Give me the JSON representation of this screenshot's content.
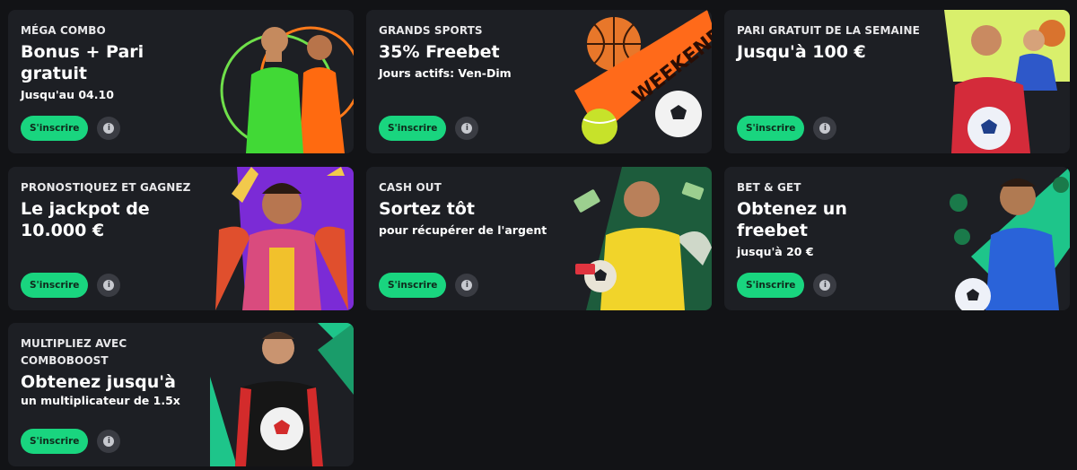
{
  "promos": [
    {
      "kicker": "MÉGA COMBO",
      "title": "Bonus + Pari gratuit",
      "sub": "Jusqu'au 04.10",
      "cta": "S'inscrire"
    },
    {
      "kicker": "GRANDS SPORTS",
      "title": "35% Freebet",
      "sub": "Jours actifs: Ven-Dim",
      "cta": "S'inscrire",
      "banner": "WEEKEND"
    },
    {
      "kicker": "PARI GRATUIT DE LA SEMAINE",
      "title": "Jusqu'à 100 €",
      "sub": "",
      "cta": "S'inscrire"
    },
    {
      "kicker": "PRONOSTIQUEZ ET GAGNEZ",
      "title": "Le jackpot de 10.000 €",
      "sub": "",
      "cta": "S'inscrire"
    },
    {
      "kicker": "CASH OUT",
      "title": "Sortez tôt",
      "sub": "pour récupérer de l'argent",
      "cta": "S'inscrire"
    },
    {
      "kicker": "BET & GET",
      "title": "Obtenez un freebet",
      "sub": "jusqu'à 20 €",
      "cta": "S'inscrire"
    },
    {
      "kicker": "MULTIPLIEZ AVEC COMBOBOOST",
      "title": "Obtenez jusqu'à",
      "sub": "un multiplicateur de 1.5x",
      "cta": "S'inscrire"
    }
  ],
  "colors": {
    "accent": "#19d57f",
    "card": "#1d1f24",
    "page": "#121316"
  },
  "icons": {
    "info": "info-icon"
  }
}
